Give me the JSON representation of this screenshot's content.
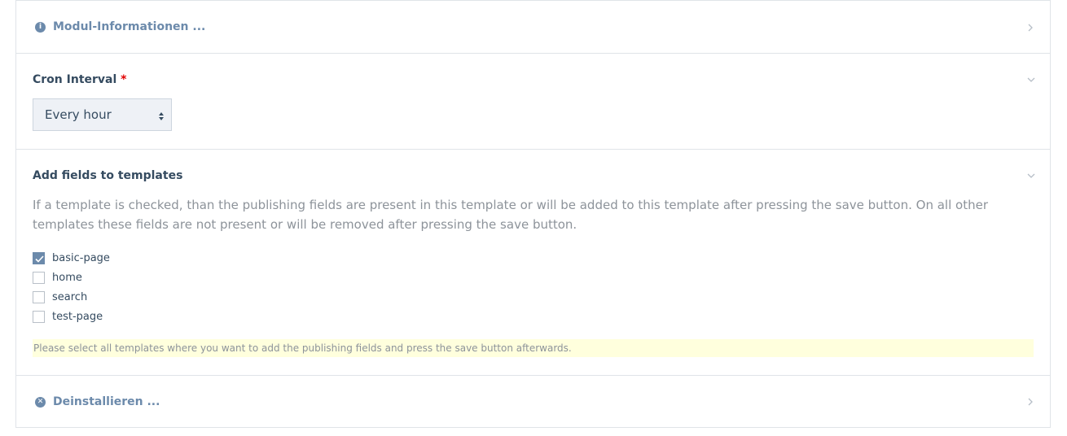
{
  "module_info": {
    "label": "Modul-Informationen ...",
    "icon": "info-icon"
  },
  "cron": {
    "label": "Cron Interval",
    "required_mark": "*",
    "selected": "Every hour"
  },
  "templates": {
    "title": "Add fields to templates",
    "description": "If a template is checked, than the publishing fields are present in this template or will be added to this template after pressing the save button. On all other templates these fields are not present or will be removed after pressing the save button.",
    "options": [
      {
        "label": "basic-page",
        "checked": true
      },
      {
        "label": "home",
        "checked": false
      },
      {
        "label": "search",
        "checked": false
      },
      {
        "label": "test-page",
        "checked": false
      }
    ],
    "note": "Please select all templates where you want to add the publishing fields and press the save button afterwards."
  },
  "uninstall": {
    "label": "Deinstallieren ...",
    "icon": "times-circle-icon"
  },
  "colors": {
    "accent": "#6c8aab",
    "text": "#354b60",
    "required": "#e10000",
    "note_bg": "#ffffdd",
    "border": "#e0e4e8"
  }
}
